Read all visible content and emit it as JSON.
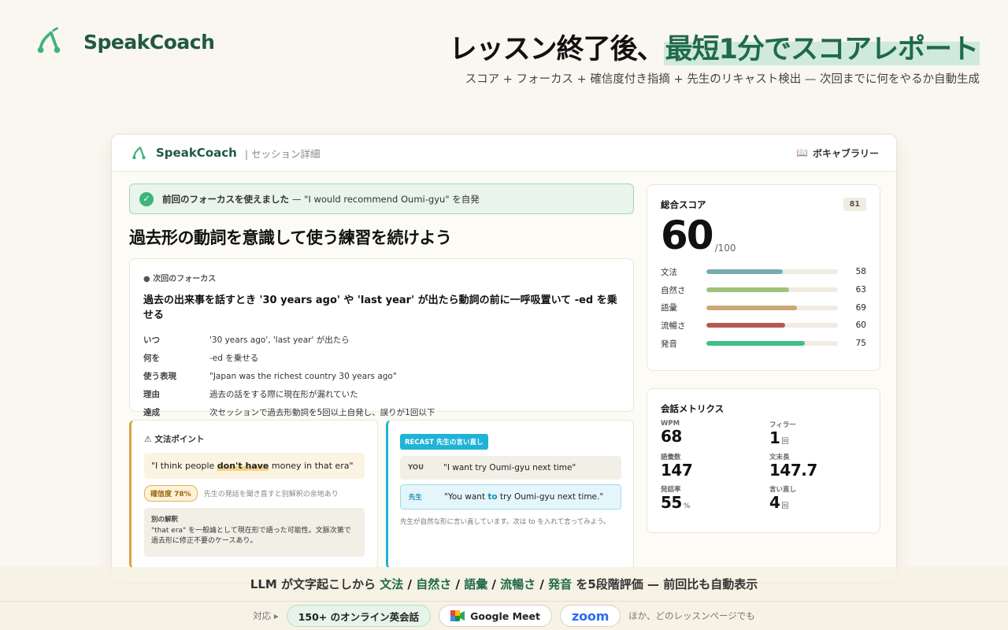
{
  "brand": {
    "name": "SpeakCoach"
  },
  "hero": {
    "title_pre": "レッスン終了後、",
    "title_highlight": "最短1分でスコアレポート",
    "subtitle": "スコア + フォーカス + 確信度付き指摘 + 先生のリキャスト検出 — 次回までに何をやるか自動生成"
  },
  "window": {
    "brand": "SpeakCoach",
    "crumb": "| セッション詳細",
    "vocab_label": "ボキャブラリー",
    "banner": {
      "bold": "前回のフォーカスを使えました",
      "rest": "— \"I would recommend Oumi-gyu\" を自発"
    },
    "title": "過去形の動詞を意識して使う練習を続けよう",
    "focus": {
      "label": "● 次回のフォーカス",
      "main": "過去の出来事を話すとき '30 years ago' や 'last year' が出たら動詞の前に一呼吸置いて -ed を乗せる",
      "rows": [
        {
          "k": "いつ",
          "v": "'30 years ago', 'last year' が出たら"
        },
        {
          "k": "何を",
          "v": "-ed を乗せる"
        },
        {
          "k": "使う表現",
          "v": "\"Japan was the richest country 30 years ago\""
        },
        {
          "k": "理由",
          "v": "過去の話をする際に現在形が漏れていた"
        },
        {
          "k": "達成",
          "v": "次セッションで過去形動詞を5回以上自発し、誤りが1回以下"
        }
      ]
    },
    "grammar": {
      "heading": "文法ポイント",
      "quote_pre": "\"I think people ",
      "quote_mark": "don't have",
      "quote_post": " money in that era\"",
      "confidence": "確信度 78%",
      "confidence_note": "先生の発話を聞き直すと別解釈の余地あり",
      "alt_label": "別の解釈",
      "alt_text": "\"that era\" を一般論として現在形で語った可能性。文脈次第で過去形に修正不要のケースあり。"
    },
    "recast": {
      "tag": "RECAST 先生の言い直し",
      "you_label": "YOU",
      "you_text": "\"I want try Oumi-gyu next time\"",
      "sensei_label": "先生",
      "sensei_pre": "\"You want ",
      "sensei_to": "to",
      "sensei_post": " try Oumi-gyu next time.\"",
      "note": "先生が自然な形に言い直しています。次は to を入れて言ってみよう。"
    },
    "score": {
      "label": "総合スコア",
      "previous": "81",
      "value": "60",
      "denominator": "/100",
      "bars": [
        {
          "label": "文法",
          "value": 58,
          "color": "#7aabb0"
        },
        {
          "label": "自然さ",
          "value": 63,
          "color": "#9fc27a"
        },
        {
          "label": "語彙",
          "value": 69,
          "color": "#c9a974"
        },
        {
          "label": "流暢さ",
          "value": 60,
          "color": "#b65a4e"
        },
        {
          "label": "発音",
          "value": 75,
          "color": "#3fbf8a"
        }
      ]
    },
    "metrics": {
      "title": "会話メトリクス",
      "items": [
        {
          "label": "WPM",
          "value": "68",
          "unit": ""
        },
        {
          "label": "フィラー",
          "value": "1",
          "unit": "回"
        },
        {
          "label": "語彙数",
          "value": "147",
          "unit": ""
        },
        {
          "label": "文末長",
          "value": "147.7",
          "unit": ""
        },
        {
          "label": "発話率",
          "value": "55",
          "unit": "%"
        },
        {
          "label": "言い直し",
          "value": "4",
          "unit": "回"
        }
      ]
    }
  },
  "caption": {
    "pre": "LLM が文字起こしから ",
    "items": [
      "文法",
      "自然さ",
      "語彙",
      "流暢さ",
      "発音"
    ],
    "post": " を5段階評価 — 前回比も自動表示"
  },
  "support": {
    "label": "対応 ▸",
    "chip1": "150+ のオンライン英会話",
    "chip2": "Google Meet",
    "chip3": "zoom",
    "tail": "ほか、どのレッスンページでも"
  }
}
